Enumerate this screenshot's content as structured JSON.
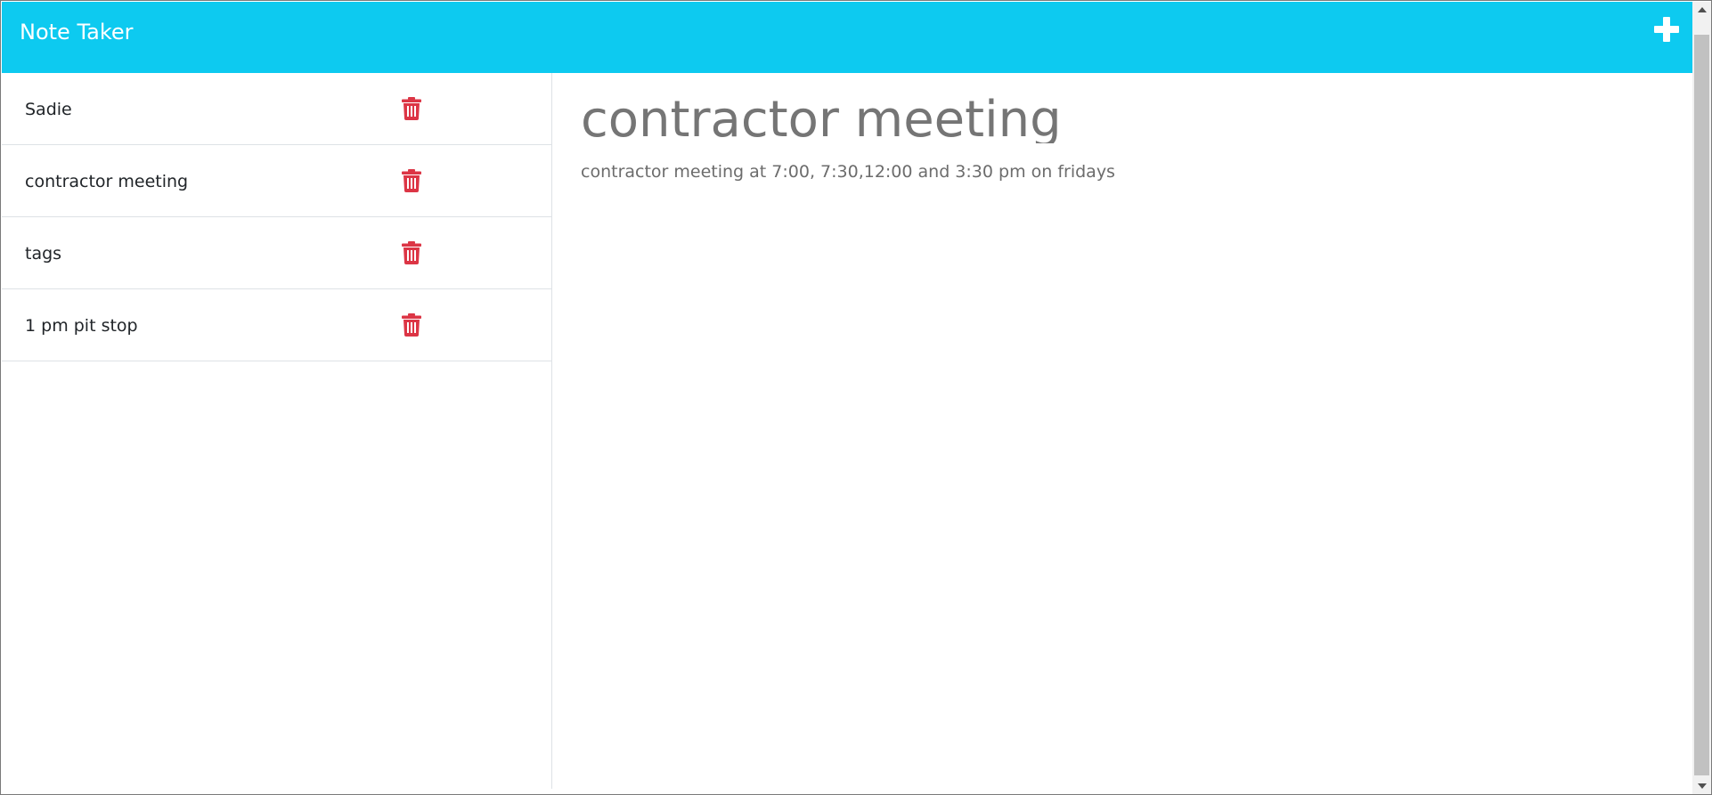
{
  "app": {
    "title": "Note Taker",
    "accent_color": "#0dcaf0",
    "new_note_icon": "plus-icon"
  },
  "notes": [
    {
      "title": "Sadie",
      "delete_icon": "trash-icon"
    },
    {
      "title": "contractor meeting",
      "delete_icon": "trash-icon"
    },
    {
      "title": "tags",
      "delete_icon": "trash-icon"
    },
    {
      "title": "1 pm pit stop",
      "delete_icon": "trash-icon"
    }
  ],
  "active_note": {
    "title": "contractor meeting",
    "text": "contractor meeting at 7:00, 7:30,12:00 and 3:30 pm on fridays"
  },
  "colors": {
    "delete": "#dc3545",
    "divider": "#dee2e6"
  }
}
